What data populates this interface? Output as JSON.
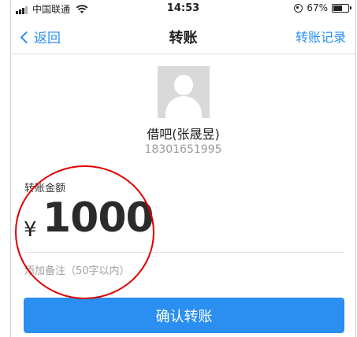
{
  "status_bar": {
    "carrier": "中国联通",
    "time": "14:53",
    "battery_percent": "67%",
    "battery_level": 0.67,
    "icons": [
      "signal-bars-icon",
      "wifi-icon",
      "orientation-lock-icon",
      "battery-icon"
    ]
  },
  "nav": {
    "back_label": "返回",
    "title": "转账",
    "right_label": "转账记录"
  },
  "recipient": {
    "name": "借吧(张晟昱)",
    "phone": "18301651995"
  },
  "amount_section": {
    "label": "转账金额",
    "currency": "¥",
    "value": "1000",
    "remark_placeholder": "添加备注（50字以内）"
  },
  "confirm_label": "确认转账",
  "colors": {
    "accent": "#2a8ff0",
    "annotation": "#e00000"
  }
}
